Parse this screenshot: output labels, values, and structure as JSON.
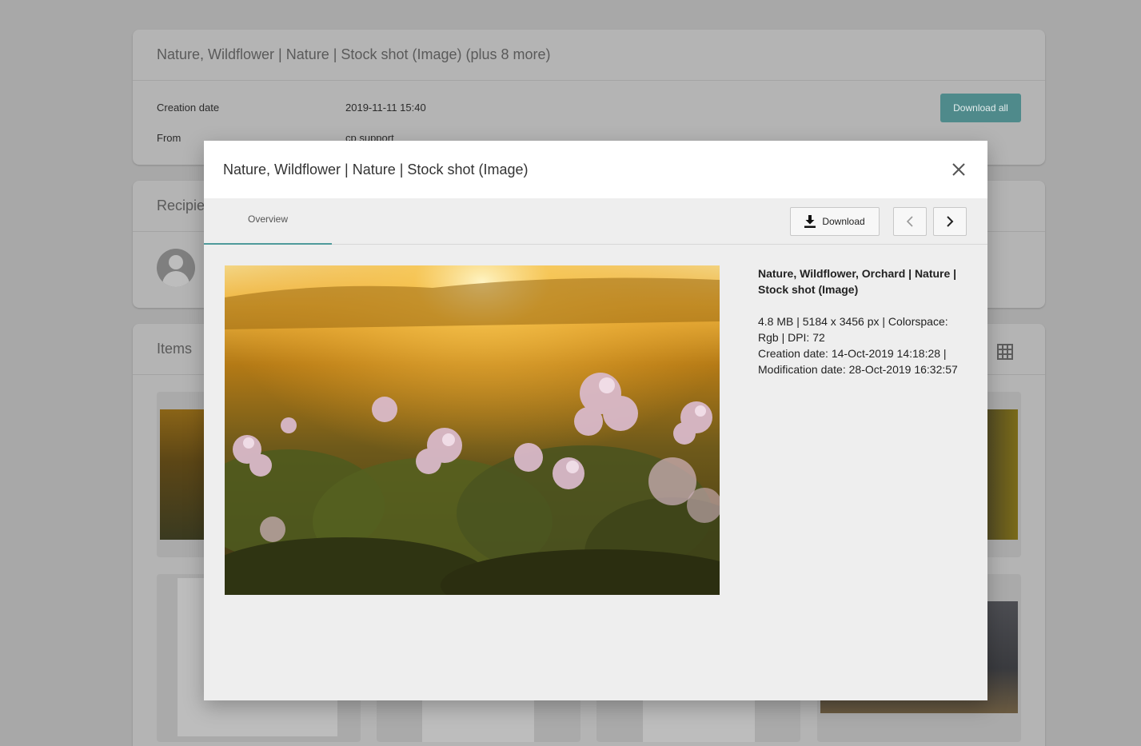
{
  "background": {
    "card1": {
      "title": "Nature, Wildflower | Nature | Stock shot (Image) (plus 8 more)",
      "creation_label": "Creation date",
      "creation_value": "2019-11-11 15:40",
      "from_label": "From",
      "from_value": "cp support",
      "download_all_label": "Download all"
    },
    "card2": {
      "title": "Recipie"
    },
    "card3": {
      "title": "Items"
    },
    "accent_color": "#4f8a8b"
  },
  "modal": {
    "title": "Nature, Wildflower | Nature | Stock shot (Image)",
    "tab_overview": "Overview",
    "download_label": "Download",
    "details": {
      "title": "Nature, Wildflower, Orchard | Nature | Stock shot (Image)",
      "line1": "4.8 MB | 5184 x 3456 px | Colorspace: Rgb | DPI: 72",
      "line2": "Creation date: 14-Oct-2019 14:18:28 | Modification date: 28-Oct-2019 16:32:57"
    },
    "tab_accent_color": "#4f9a9b"
  }
}
